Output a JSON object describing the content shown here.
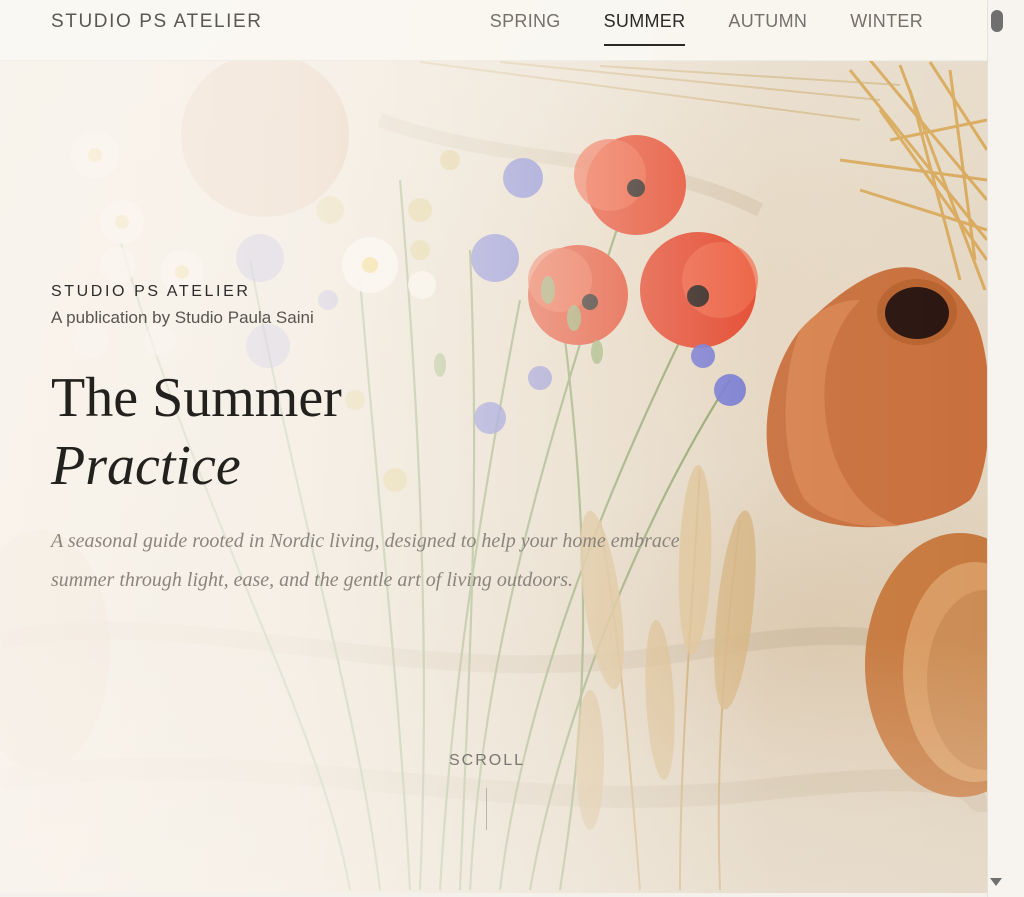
{
  "header": {
    "brand": "STUDIO PS ATELIER",
    "nav": [
      {
        "label": "SPRING",
        "active": false
      },
      {
        "label": "SUMMER",
        "active": true
      },
      {
        "label": "AUTUMN",
        "active": false
      },
      {
        "label": "WINTER",
        "active": false
      }
    ]
  },
  "hero": {
    "eyebrow": "STUDIO PS ATELIER",
    "byline": "A publication by Studio Paula Saini",
    "title_line1": "The Summer",
    "title_line2": "Practice",
    "lede": "A seasonal guide rooted in Nordic living, designed to help your home embrace summer through light, ease, and the gentle art of living outdoors.",
    "scroll_label": "SCROLL",
    "image_subject": "wildflowers-poppies-wheat-clay-pots-on-linen"
  },
  "colors": {
    "text_dark": "#23211e",
    "text_muted": "#8a847c",
    "poppy_red": "#e04a2a",
    "cornflower": "#6f74cf",
    "terracotta": "#c8713f",
    "linen": "#e6dac7"
  }
}
